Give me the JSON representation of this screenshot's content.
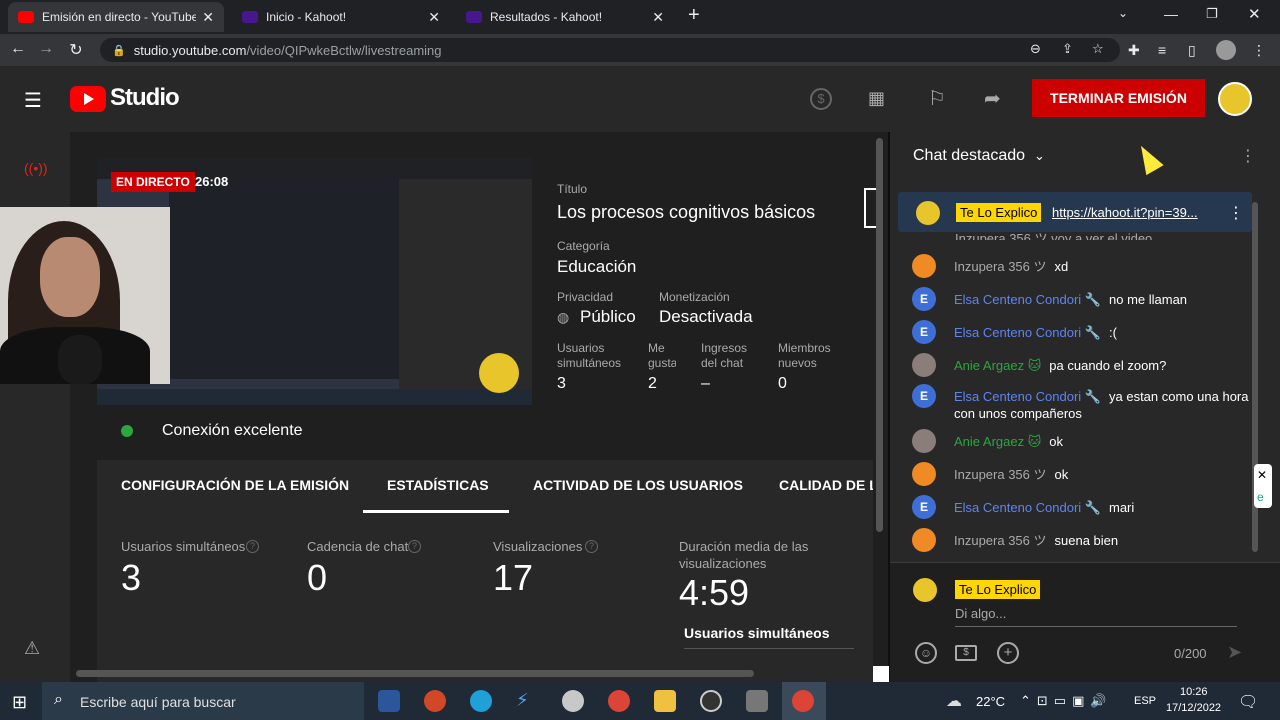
{
  "browser": {
    "tabs": [
      {
        "title": "Emisión en directo - YouTube Stu",
        "close": "✕"
      },
      {
        "title": "Inicio - Kahoot!",
        "close": "✕"
      },
      {
        "title": "Resultados - Kahoot!",
        "close": "✕"
      }
    ],
    "new_tab": "+",
    "url_host": "studio.youtube.com",
    "url_path": "/video/QIPwkeBctlw/livestreaming"
  },
  "header": {
    "logo_text": "Studio",
    "end_button": "TERMINAR EMISIÓN"
  },
  "preview": {
    "live_badge": "EN DIRECTO",
    "timer": "26:08"
  },
  "meta": {
    "title_label": "Título",
    "title_value": "Los procesos cognitivos básicos",
    "category_label": "Categoría",
    "category_value": "Educación",
    "privacy_label": "Privacidad",
    "privacy_value": "Público",
    "monet_label": "Monetización",
    "monet_value": "Desactivada",
    "concurrent_label1": "Usuarios",
    "concurrent_label2": "simultáneos",
    "concurrent_value": "3",
    "likes_label1": "Me",
    "likes_label2": "gusta",
    "likes_value": "2",
    "chat_income_label1": "Ingresos",
    "chat_income_label2": "del chat",
    "chat_income_value": "–",
    "members_label1": "Miembros",
    "members_label2": "nuevos",
    "members_value": "0"
  },
  "connection": "Conexión excelente",
  "tabs": [
    "CONFIGURACIÓN DE LA EMISIÓN",
    "ESTADÍSTICAS",
    "ACTIVIDAD DE LOS USUARIOS",
    "CALIDAD DE LA"
  ],
  "stats": {
    "concurrent_label": "Usuarios simultáneos",
    "concurrent_value": "3",
    "chat_rate_label": "Cadencia de chat",
    "chat_rate_value": "0",
    "views_label": "Visualizaciones",
    "views_value": "17",
    "avg_dur_label1": "Duración media de las",
    "avg_dur_label2": "visualizaciones",
    "avg_dur_value": "4:59",
    "sub_heading": "Usuarios simultáneos"
  },
  "chat": {
    "header": "Chat destacado",
    "pinned_user": "Te Lo Explico",
    "pinned_link": "https://kahoot.it?pin=39...",
    "partial_top": "Inzupera 356 ツ voy a ver el video",
    "messages": [
      {
        "user": "Inzupera 356 ツ",
        "text": "xd",
        "color": "#aaaaaa",
        "avatar": "#f08a24"
      },
      {
        "user": "Elsa Centeno Condori 🔧",
        "text": "no me llaman",
        "color": "#5e84f1",
        "avatar": "#3f6fd6",
        "initial": "E"
      },
      {
        "user": "Elsa Centeno Condori 🔧",
        "text": ":(",
        "color": "#5e84f1",
        "avatar": "#3f6fd6",
        "initial": "E"
      },
      {
        "user": "Anie Argaez 🐱",
        "text": "pa cuando el zoom?",
        "color": "#2ba640",
        "avatar": "#8a7d7a"
      },
      {
        "user": "Elsa Centeno Condori 🔧",
        "text": "ya estan como una hora con unos compañeros",
        "color": "#5e84f1",
        "avatar": "#3f6fd6",
        "initial": "E"
      },
      {
        "user": "Anie Argaez 🐱",
        "text": "ok",
        "color": "#2ba640",
        "avatar": "#8a7d7a"
      },
      {
        "user": "Inzupera 356 ツ",
        "text": "ok",
        "color": "#aaaaaa",
        "avatar": "#f08a24"
      },
      {
        "user": "Elsa Centeno Condori 🔧",
        "text": "mari",
        "color": "#5e84f1",
        "avatar": "#3f6fd6",
        "initial": "E"
      },
      {
        "user": "Inzupera 356 ツ",
        "text": "suena bien",
        "color": "#aaaaaa",
        "avatar": "#f08a24"
      }
    ],
    "input_user": "Te Lo Explico",
    "input_placeholder": "Di algo...",
    "counter": "0/200"
  },
  "taskbar": {
    "search_placeholder": "Escribe aquí para buscar",
    "temp": "22°C",
    "lang": "ESP",
    "time": "10:26",
    "date": "17/12/2022"
  }
}
